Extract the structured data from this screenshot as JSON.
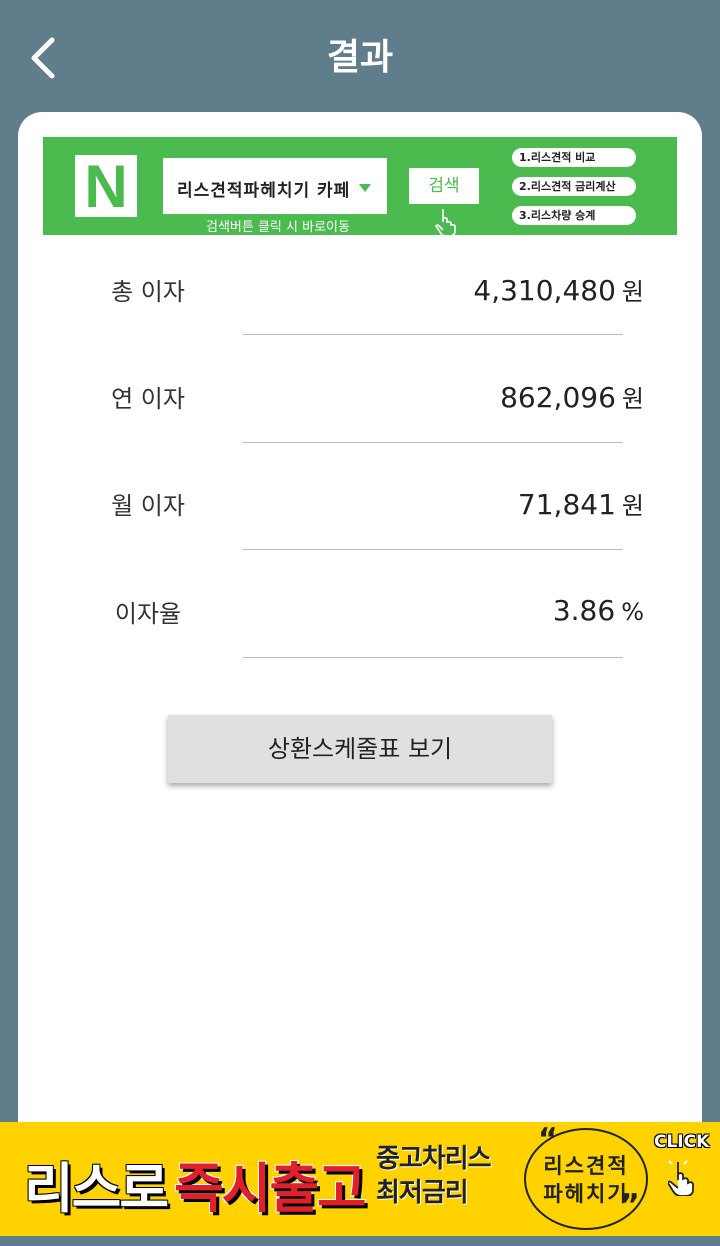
{
  "header": {
    "title": "결과"
  },
  "banner": {
    "logo_letter": "N",
    "search_text": "리스견적파헤치기 카페",
    "search_button": "검색",
    "hint": "검색버튼 클릭 시 바로이동",
    "links": [
      "1.리스견적 비교",
      "2.리스견적 금리계산",
      "3.리스차량 승계"
    ],
    "color": "#4cbb4f"
  },
  "results": {
    "total": {
      "label": "총 이자",
      "value": "4,310,480",
      "unit": "원"
    },
    "yearly": {
      "label": "연 이자",
      "value": "862,096",
      "unit": "원"
    },
    "monthly": {
      "label": "월 이자",
      "value": "71,841",
      "unit": "원"
    },
    "rate": {
      "label": "이자율",
      "value": "3.86",
      "unit": "%"
    }
  },
  "schedule_button": "상환스케줄표 보기",
  "ad": {
    "text1": "리스로",
    "text2": "즉시출고",
    "text3_line1": "중고차리스",
    "text3_line2": "최저금리",
    "circle_line1": "리스견적",
    "circle_line2": "파헤치기",
    "click": "CLICK",
    "background": "#ffd200"
  }
}
